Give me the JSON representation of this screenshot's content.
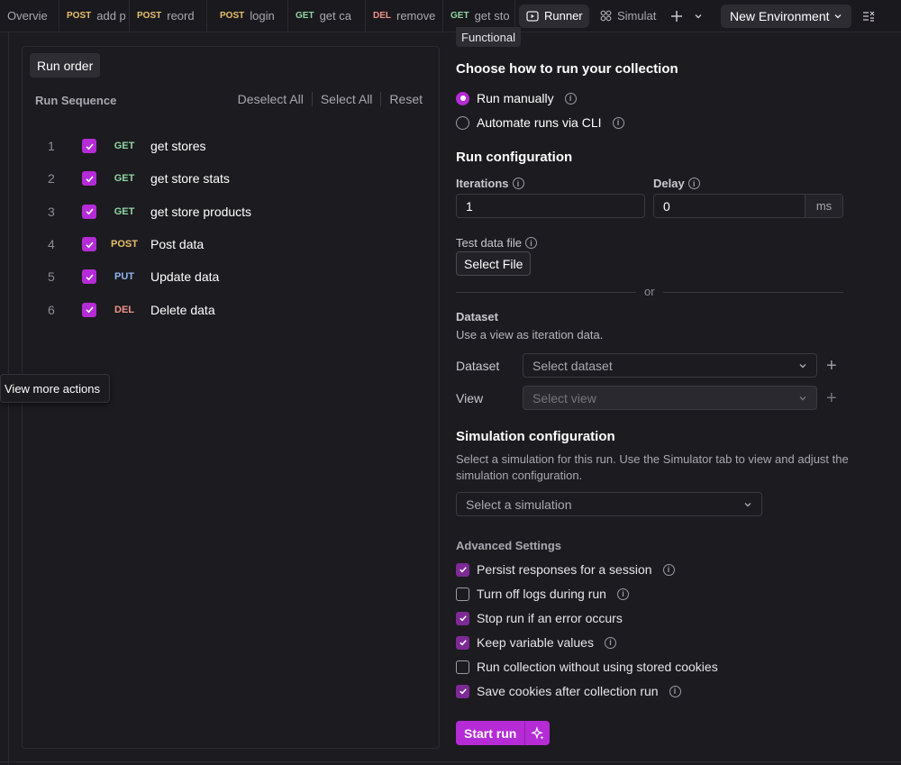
{
  "tabs": [
    {
      "method": "",
      "label": "Overvie",
      "method_class": ""
    },
    {
      "method": "POST",
      "label": "add p",
      "method_class": "m-post"
    },
    {
      "method": "POST",
      "label": "reord",
      "method_class": "m-post"
    },
    {
      "method": "POST",
      "label": "login",
      "method_class": "m-post"
    },
    {
      "method": "GET",
      "label": "get ca",
      "method_class": "m-get"
    },
    {
      "method": "DEL",
      "label": "remove",
      "method_class": "m-del"
    },
    {
      "method": "GET",
      "label": "get sto",
      "method_class": "m-get"
    }
  ],
  "active_tab": {
    "label": "Runner",
    "icon": "play-box-icon"
  },
  "simulator_tab": {
    "label": "Simulat",
    "icon": "simulator-icon"
  },
  "environment": {
    "label": "New Environment"
  },
  "left": {
    "run_order_label": "Run order",
    "sequence_label": "Run Sequence",
    "deselect_all": "Deselect All",
    "select_all": "Select All",
    "reset": "Reset",
    "requests": [
      {
        "num": "1",
        "method": "GET",
        "name": "get stores",
        "checked": true
      },
      {
        "num": "2",
        "method": "GET",
        "name": "get store stats",
        "checked": true
      },
      {
        "num": "3",
        "method": "GET",
        "name": "get store products",
        "checked": true
      },
      {
        "num": "4",
        "method": "POST",
        "name": "Post data",
        "checked": true
      },
      {
        "num": "5",
        "method": "PUT",
        "name": "Update data",
        "checked": true
      },
      {
        "num": "6",
        "method": "DEL",
        "name": "Delete data",
        "checked": true
      }
    ]
  },
  "tooltip": "View more actions",
  "right": {
    "functional_label": "Functional",
    "how_to_run_heading": "Choose how to run your collection",
    "run_manually": "Run manually",
    "automate_cli": "Automate runs via CLI",
    "run_config_heading": "Run configuration",
    "iterations_label": "Iterations",
    "iterations_value": "1",
    "delay_label": "Delay",
    "delay_value": "0",
    "delay_unit": "ms",
    "test_data_label": "Test data file",
    "select_file": "Select File",
    "or": "or",
    "dataset_heading": "Dataset",
    "dataset_desc": "Use a view as iteration data.",
    "dataset_field": "Dataset",
    "dataset_placeholder": "Select dataset",
    "view_field": "View",
    "view_placeholder": "Select view",
    "simulation_heading": "Simulation configuration",
    "simulation_desc": "Select a simulation for this run. Use the Simulator tab to view and adjust the simulation configuration.",
    "simulation_placeholder": "Select a simulation",
    "advanced_heading": "Advanced Settings",
    "options": [
      {
        "label": "Persist responses for a session",
        "checked": true,
        "info": true
      },
      {
        "label": "Turn off logs during run",
        "checked": false,
        "info": true
      },
      {
        "label": "Stop run if an error occurs",
        "checked": true,
        "info": false
      },
      {
        "label": "Keep variable values",
        "checked": true,
        "info": true
      },
      {
        "label": "Run collection without using stored cookies",
        "checked": false,
        "info": false
      },
      {
        "label": "Save cookies after collection run",
        "checked": true,
        "info": true
      }
    ],
    "start_run": "Start run"
  },
  "colors": {
    "accent": "#b52bd6",
    "background": "#1c1b20",
    "get": "#8fd6a3",
    "post": "#e8c06a",
    "put": "#8fb6f0",
    "del": "#f0938a"
  }
}
